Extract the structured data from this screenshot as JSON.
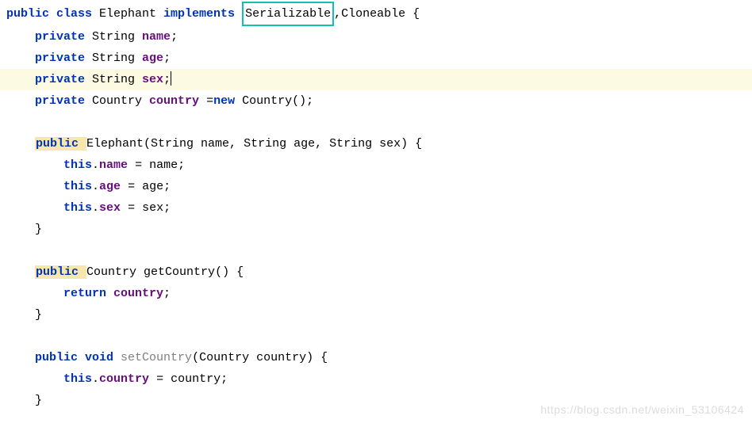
{
  "watermark": "https://blog.csdn.net/weixin_53106424",
  "code": {
    "l0": {
      "kw_public": "public ",
      "kw_class": "class ",
      "name": "Elephant ",
      "kw_implements": "implements",
      "space1": " ",
      "iface1": "Serializable",
      "comma": ",",
      "iface2": "Cloneable ",
      "brace": "{"
    },
    "l1": {
      "indent": "    ",
      "kw": "private ",
      "type": "String ",
      "field": "name",
      "semi": ";"
    },
    "l2": {
      "indent": "    ",
      "kw": "private ",
      "type": "String ",
      "field": "age",
      "semi": ";"
    },
    "l3": {
      "indent": "    ",
      "kw": "private ",
      "type": "String ",
      "field": "sex",
      "semi": ";"
    },
    "l4": {
      "indent": "    ",
      "kw": "private ",
      "type": "Country ",
      "field": "country",
      "eq": " =",
      "kw_new": "new ",
      "ctor": "Country();"
    },
    "l6": {
      "indent": "    ",
      "kw": "public ",
      "sig": "Elephant(String name, String age, String sex) {"
    },
    "l7": {
      "indent": "        ",
      "kw_this": "this",
      "dot": ".",
      "field": "name",
      "rest": " = name;"
    },
    "l8": {
      "indent": "        ",
      "kw_this": "this",
      "dot": ".",
      "field": "age",
      "rest": " = age;"
    },
    "l9": {
      "indent": "        ",
      "kw_this": "this",
      "dot": ".",
      "field": "sex",
      "rest": " = sex;"
    },
    "l10": {
      "indent": "    ",
      "brace": "}"
    },
    "l12": {
      "indent": "    ",
      "kw": "public ",
      "type": "Country ",
      "method": "getCountry",
      "parens": "() {"
    },
    "l13": {
      "indent": "        ",
      "kw_return": "return ",
      "field": "country",
      "semi": ";"
    },
    "l14": {
      "indent": "    ",
      "brace": "}"
    },
    "l16": {
      "indent": "    ",
      "kw": "public ",
      "kw_void": "void ",
      "method": "setCountry",
      "params": "(Country country) {"
    },
    "l17": {
      "indent": "        ",
      "kw_this": "this",
      "dot": ".",
      "field": "country",
      "rest": " = country;"
    },
    "l18": {
      "indent": "    ",
      "brace": "}"
    }
  }
}
